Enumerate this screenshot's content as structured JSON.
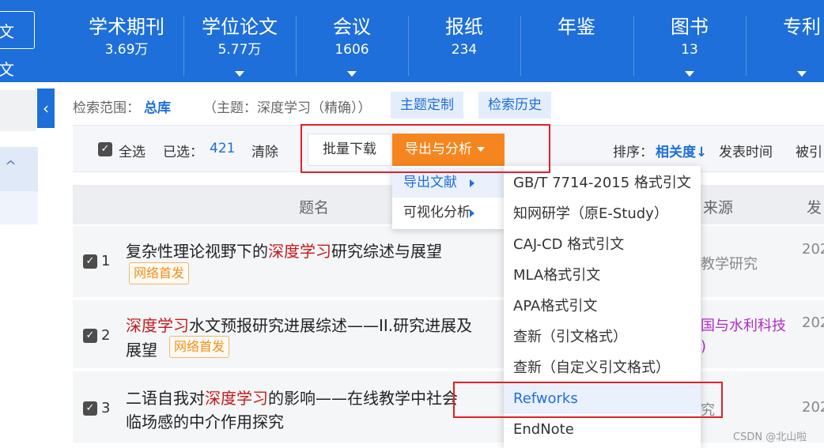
{
  "topbar": {
    "left_text_1": "文",
    "left_text_2": "文",
    "categories": [
      {
        "name": "学术期刊",
        "count": "3.69万"
      },
      {
        "name": "学位论文",
        "count": "5.77万"
      },
      {
        "name": "会议",
        "count": "1606"
      },
      {
        "name": "报纸",
        "count": "234"
      },
      {
        "name": "年鉴",
        "count": ""
      },
      {
        "name": "图书",
        "count": "13"
      },
      {
        "name": "专利",
        "count": ""
      }
    ],
    "background_color": "#1e6fd9"
  },
  "sidebar": {
    "collapse_icon": "chevron-left-icon",
    "caret_glyph": "^"
  },
  "scope": {
    "label": "检索范围：",
    "value": "总库",
    "topic": "（主题：深度学习（精确））",
    "topic_button": "主题定制",
    "history_button": "检索历史"
  },
  "toolbar": {
    "select_all": "全选",
    "selected_label": "已选：",
    "selected_count": "421",
    "clear": "清除",
    "batch_download": "批量下载",
    "export_analysis": "导出与分析",
    "sort_label": "排序：",
    "sort_active": "相关度",
    "sort_arrow": "↓",
    "sort_publish_time": "发表时间",
    "sort_cited": "被引"
  },
  "table": {
    "headers": {
      "title": "题名",
      "source": "来源",
      "date": "发"
    },
    "rows": [
      {
        "num": "1",
        "title_pre": "复杂性理论视野下的",
        "title_hl": "深度学习",
        "title_post": "研究综述与展望",
        "title_line2": "",
        "tag": "网络首发",
        "source": "教学研究",
        "year": "202"
      },
      {
        "num": "2",
        "title_pre": "",
        "title_hl": "深度学习",
        "title_post": "水文预报研究进展综述——II.研究进展及",
        "title_line2": "展望",
        "tag": "网络首发",
        "source": "国与水利科技",
        "source_line2": ")",
        "year": "202"
      },
      {
        "num": "3",
        "title_pre": "二语自我对",
        "title_hl": "深度学习",
        "title_post": "的影响——在线教学中社会",
        "title_line2": "临场感的中介作用探究",
        "tag": "",
        "source": "究",
        "year": "202"
      }
    ]
  },
  "export_menu": {
    "items": [
      "导出文献",
      "可视化分析"
    ],
    "submenu": [
      "GB/T 7714-2015 格式引文",
      "知网研学（原E-Study）",
      "CAJ-CD 格式引文",
      "MLA格式引文",
      "APA格式引文",
      "查新（引文格式）",
      "查新（自定义引文格式）",
      "Refworks",
      "EndNote"
    ]
  },
  "watermark": "CSDN @北山啦",
  "colors": {
    "accent": "#1e6fd9",
    "export_button": "#f5861f",
    "highlight": "#c41a1a",
    "annotation_red": "#e0202a"
  }
}
